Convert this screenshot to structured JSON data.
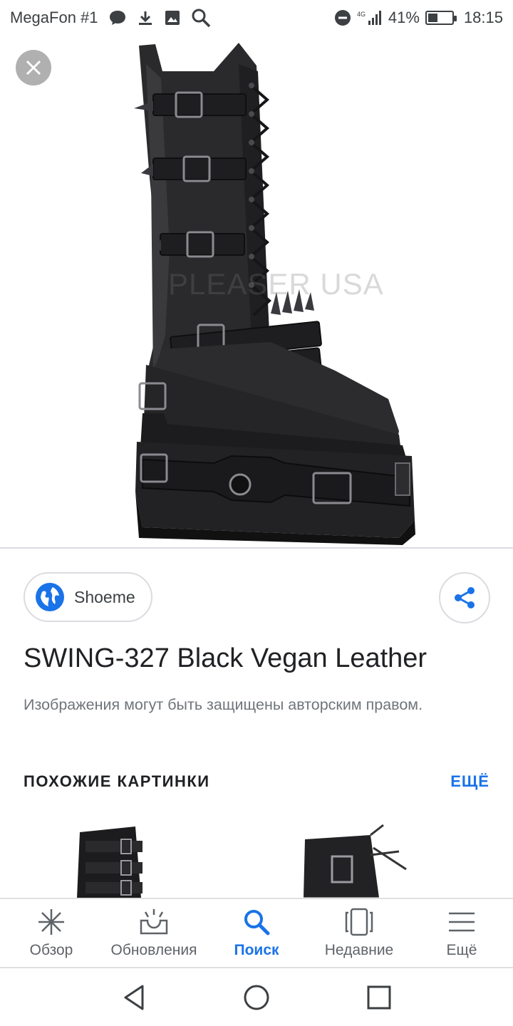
{
  "status_bar": {
    "carrier": "MegaFon #1",
    "network": "4G",
    "battery": "41%",
    "battery_level": 0.41,
    "time": "18:15",
    "icons": [
      "chat-bubble-icon",
      "download-icon",
      "image-icon",
      "search-icon",
      "dnd-icon",
      "signal-icon",
      "battery-icon"
    ]
  },
  "viewer": {
    "close_icon": "close-icon",
    "watermark": "PLEASER USA"
  },
  "source": {
    "name": "Shoeme",
    "icon": "globe-icon"
  },
  "share_icon": "share-icon",
  "title": "SWING-327 Black Vegan Leather",
  "copyright_notice": "Изображения могут быть защищены авторским правом.",
  "similar": {
    "heading": "ПОХОЖИЕ КАРТИНКИ",
    "more": "ЕЩЁ"
  },
  "bottom_nav": {
    "items": [
      {
        "label": "Обзор",
        "icon": "discover-icon"
      },
      {
        "label": "Обновления",
        "icon": "updates-icon"
      },
      {
        "label": "Поиск",
        "icon": "search-icon",
        "active": true
      },
      {
        "label": "Недавние",
        "icon": "recent-tabs-icon"
      },
      {
        "label": "Ещё",
        "icon": "menu-icon"
      }
    ]
  },
  "system_nav": [
    "back-icon",
    "home-icon",
    "recents-icon"
  ],
  "colors": {
    "accent": "#1a73e8",
    "text_primary": "#202124",
    "text_secondary": "#70757a",
    "border": "#dadce0"
  }
}
